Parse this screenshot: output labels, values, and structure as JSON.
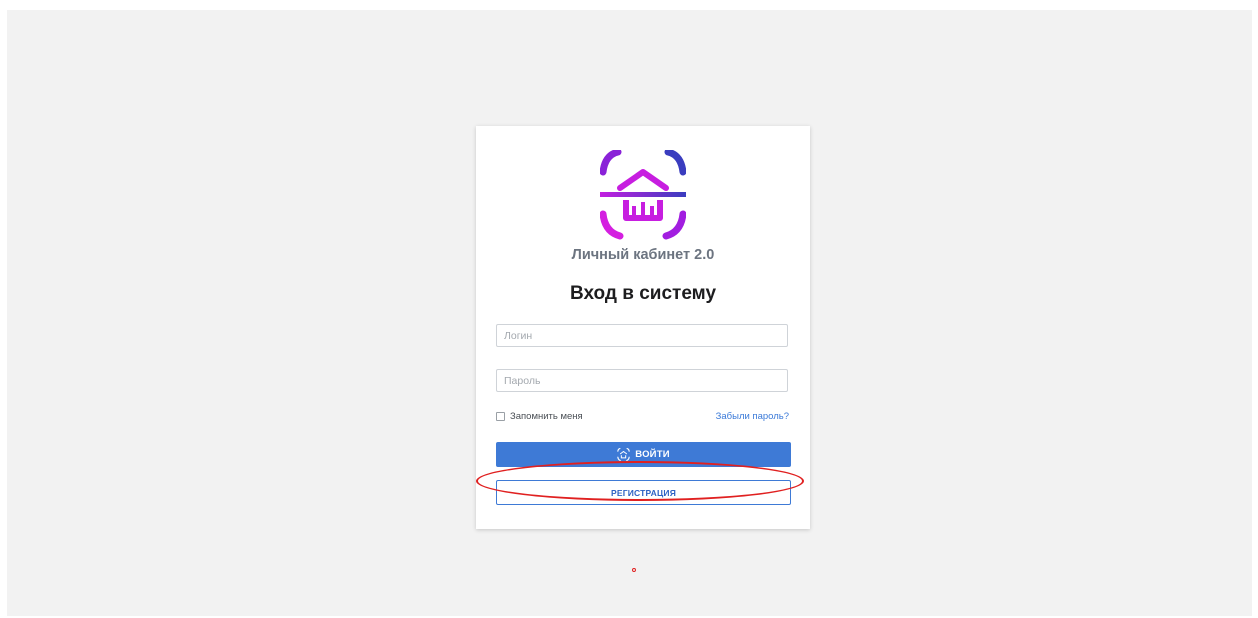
{
  "brand": {
    "name": "Личный кабинет 2.0",
    "logo_icon": "house-scan-logo-icon",
    "gradient_colors": [
      "#c31ee0",
      "#3a3dbf"
    ]
  },
  "form": {
    "title": "Вход в систему",
    "login_placeholder": "Логин",
    "password_placeholder": "Пароль",
    "remember_label": "Запомнить меня",
    "forgot_link": "Забыли пароль?",
    "login_button": "ВОЙТИ",
    "register_button": "РЕГИСТРАЦИЯ"
  },
  "colors": {
    "primary": "#3e7ad6",
    "annotation": "#e02020",
    "background": "#f2f2f2"
  }
}
